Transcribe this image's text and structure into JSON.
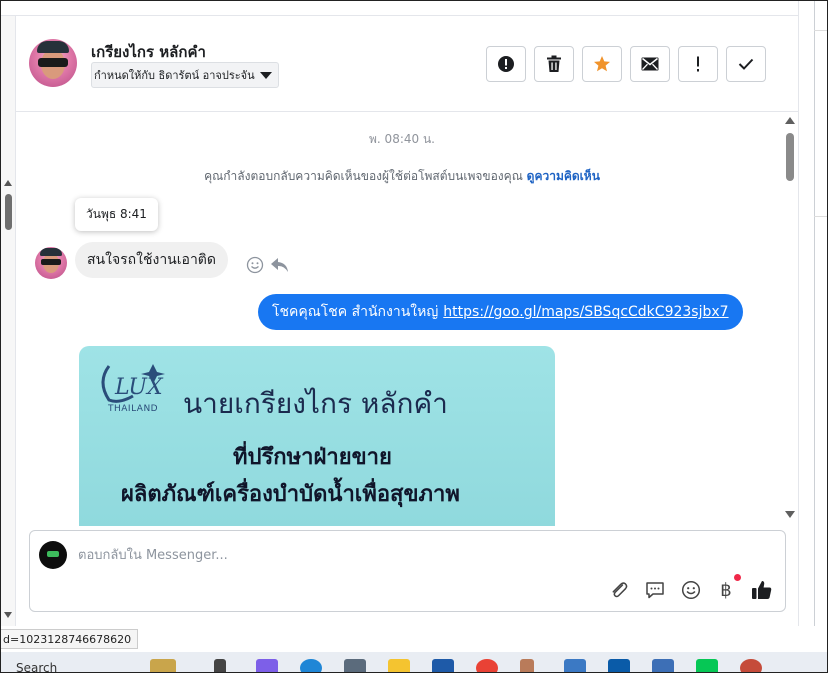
{
  "header": {
    "contact_name": "เกรียงไกร หลักคำ",
    "assigned_to": "กำหนดให้กับ ธิดารัตน์ อาจประจัน",
    "toolbar": {
      "spam_icon": "exclamation-circle-icon",
      "delete_icon": "trash-icon",
      "star_icon": "star-icon",
      "star_color": "#f0932b",
      "unread_icon": "envelope-icon",
      "follow_up_icon": "exclamation-icon",
      "done_icon": "checkmark-icon"
    }
  },
  "messages": {
    "timestamp": "พ. 08:40 น.",
    "notice_text": "คุณกำลังตอบกลับความคิดเห็นของผู้ใช้ต่อโพสต์บนเพจของคุณ",
    "notice_link": "ดูความคิดเห็น",
    "tooltip_time": "วันพุธ 8:41",
    "incoming_text": "สนใจรถใช้งานเอาติด",
    "outgoing_text": "โชคคุณโชค สำนักงานใหญ่",
    "outgoing_link": "https://goo.gl/maps/SBSqcCdkC923sjbx7",
    "outgoing_color": "#1877f2",
    "card": {
      "logo_text": "THAILAND",
      "line1": "นายเกรียงไกร  หลักคำ",
      "line2": "ที่ปรึกษาฝ่ายขาย",
      "line3": "ผลิตภัณฑ์เครื่องบำบัดน้ำเพื่อสุขภาพ"
    }
  },
  "composer": {
    "placeholder": "ตอบกลับใน Messenger...",
    "icons": [
      "paperclip-icon",
      "chat-bubble-icon",
      "emoji-icon",
      "baht-icon",
      "thumbs-up-icon"
    ],
    "baht_symbol": "฿"
  },
  "status_url": "d=1023128746678620",
  "taskbar": {
    "search_label": "Search"
  }
}
